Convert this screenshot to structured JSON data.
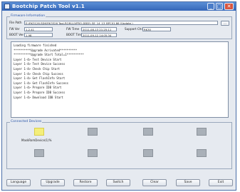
{
  "window": {
    "title": "Bootchip Patch Tool v1.1"
  },
  "firmware": {
    "group_title": "Firmware Information",
    "file_path_label": "File Path",
    "file_path_value": "E:\\RK3126-SDK\\RK3326 Tool-ROM-LIVPRO-DDD\\\\ SE_14_13_BPC01.86 (Update.)",
    "browse_label": "...",
    "fw_ver_label": "FW Ver",
    "fw_ver_value": "1.2.41",
    "fw_time_label": "FW Time",
    "fw_time_value": "2011-08-13 21:25:11",
    "support_chip_label": "Support Chip",
    "support_chip_value": "RK30",
    "boot_ver_label": "BOOT Ver",
    "boot_ver_value": "1.98",
    "boot_time_label": "BOOT Time",
    "boot_time_value": "2011-09-12 14:05:34"
  },
  "log": {
    "lines": [
      "Loading firmware finished",
      "**********Upgrade Acrivated**********",
      "**********Upgrade Start Total=1**********",
      "Layer 1-4> Test Device Start",
      "Layer 1-4> Test Device Success",
      "Layer 1-4> Check Chip Start",
      "Layer 1-4> Check Chip Success",
      "Layer 1-4> Get FlashInfo Start",
      "Layer 1-4> Get FlashInfo Success",
      "Layer 1-4> Prepare IDB Start",
      "Layer 1-4> Prepare IDB Success",
      "Layer 1-4> Download IDB Start"
    ]
  },
  "devices": {
    "group_title": "Connected Devices",
    "device_label": "MaskRomDevice(1)%"
  },
  "buttons": {
    "language": "Language",
    "upgrade": "Upgrade",
    "restore": "Restore",
    "switch": "Switch",
    "clear": "Clear",
    "save": "Save",
    "exit": "Exit"
  },
  "colors": {
    "titlebar": "#3466b8",
    "active_device": "#f4ee7a",
    "inactive_device": "#a9b0b8",
    "group_title": "#2a55a8"
  }
}
